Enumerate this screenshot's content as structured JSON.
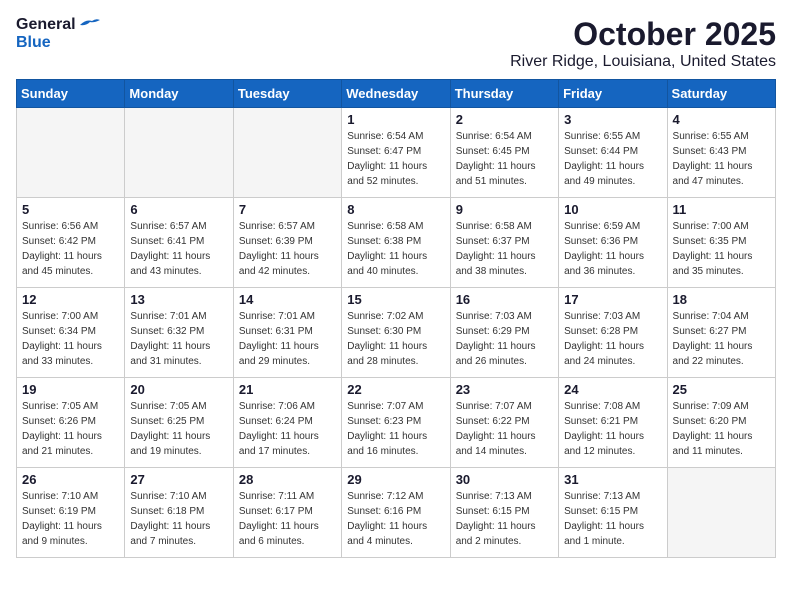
{
  "header": {
    "logo_general": "General",
    "logo_blue": "Blue",
    "month": "October 2025",
    "location": "River Ridge, Louisiana, United States"
  },
  "weekdays": [
    "Sunday",
    "Monday",
    "Tuesday",
    "Wednesday",
    "Thursday",
    "Friday",
    "Saturday"
  ],
  "weeks": [
    [
      {
        "day": "",
        "detail": ""
      },
      {
        "day": "",
        "detail": ""
      },
      {
        "day": "",
        "detail": ""
      },
      {
        "day": "1",
        "detail": "Sunrise: 6:54 AM\nSunset: 6:47 PM\nDaylight: 11 hours\nand 52 minutes."
      },
      {
        "day": "2",
        "detail": "Sunrise: 6:54 AM\nSunset: 6:45 PM\nDaylight: 11 hours\nand 51 minutes."
      },
      {
        "day": "3",
        "detail": "Sunrise: 6:55 AM\nSunset: 6:44 PM\nDaylight: 11 hours\nand 49 minutes."
      },
      {
        "day": "4",
        "detail": "Sunrise: 6:55 AM\nSunset: 6:43 PM\nDaylight: 11 hours\nand 47 minutes."
      }
    ],
    [
      {
        "day": "5",
        "detail": "Sunrise: 6:56 AM\nSunset: 6:42 PM\nDaylight: 11 hours\nand 45 minutes."
      },
      {
        "day": "6",
        "detail": "Sunrise: 6:57 AM\nSunset: 6:41 PM\nDaylight: 11 hours\nand 43 minutes."
      },
      {
        "day": "7",
        "detail": "Sunrise: 6:57 AM\nSunset: 6:39 PM\nDaylight: 11 hours\nand 42 minutes."
      },
      {
        "day": "8",
        "detail": "Sunrise: 6:58 AM\nSunset: 6:38 PM\nDaylight: 11 hours\nand 40 minutes."
      },
      {
        "day": "9",
        "detail": "Sunrise: 6:58 AM\nSunset: 6:37 PM\nDaylight: 11 hours\nand 38 minutes."
      },
      {
        "day": "10",
        "detail": "Sunrise: 6:59 AM\nSunset: 6:36 PM\nDaylight: 11 hours\nand 36 minutes."
      },
      {
        "day": "11",
        "detail": "Sunrise: 7:00 AM\nSunset: 6:35 PM\nDaylight: 11 hours\nand 35 minutes."
      }
    ],
    [
      {
        "day": "12",
        "detail": "Sunrise: 7:00 AM\nSunset: 6:34 PM\nDaylight: 11 hours\nand 33 minutes."
      },
      {
        "day": "13",
        "detail": "Sunrise: 7:01 AM\nSunset: 6:32 PM\nDaylight: 11 hours\nand 31 minutes."
      },
      {
        "day": "14",
        "detail": "Sunrise: 7:01 AM\nSunset: 6:31 PM\nDaylight: 11 hours\nand 29 minutes."
      },
      {
        "day": "15",
        "detail": "Sunrise: 7:02 AM\nSunset: 6:30 PM\nDaylight: 11 hours\nand 28 minutes."
      },
      {
        "day": "16",
        "detail": "Sunrise: 7:03 AM\nSunset: 6:29 PM\nDaylight: 11 hours\nand 26 minutes."
      },
      {
        "day": "17",
        "detail": "Sunrise: 7:03 AM\nSunset: 6:28 PM\nDaylight: 11 hours\nand 24 minutes."
      },
      {
        "day": "18",
        "detail": "Sunrise: 7:04 AM\nSunset: 6:27 PM\nDaylight: 11 hours\nand 22 minutes."
      }
    ],
    [
      {
        "day": "19",
        "detail": "Sunrise: 7:05 AM\nSunset: 6:26 PM\nDaylight: 11 hours\nand 21 minutes."
      },
      {
        "day": "20",
        "detail": "Sunrise: 7:05 AM\nSunset: 6:25 PM\nDaylight: 11 hours\nand 19 minutes."
      },
      {
        "day": "21",
        "detail": "Sunrise: 7:06 AM\nSunset: 6:24 PM\nDaylight: 11 hours\nand 17 minutes."
      },
      {
        "day": "22",
        "detail": "Sunrise: 7:07 AM\nSunset: 6:23 PM\nDaylight: 11 hours\nand 16 minutes."
      },
      {
        "day": "23",
        "detail": "Sunrise: 7:07 AM\nSunset: 6:22 PM\nDaylight: 11 hours\nand 14 minutes."
      },
      {
        "day": "24",
        "detail": "Sunrise: 7:08 AM\nSunset: 6:21 PM\nDaylight: 11 hours\nand 12 minutes."
      },
      {
        "day": "25",
        "detail": "Sunrise: 7:09 AM\nSunset: 6:20 PM\nDaylight: 11 hours\nand 11 minutes."
      }
    ],
    [
      {
        "day": "26",
        "detail": "Sunrise: 7:10 AM\nSunset: 6:19 PM\nDaylight: 11 hours\nand 9 minutes."
      },
      {
        "day": "27",
        "detail": "Sunrise: 7:10 AM\nSunset: 6:18 PM\nDaylight: 11 hours\nand 7 minutes."
      },
      {
        "day": "28",
        "detail": "Sunrise: 7:11 AM\nSunset: 6:17 PM\nDaylight: 11 hours\nand 6 minutes."
      },
      {
        "day": "29",
        "detail": "Sunrise: 7:12 AM\nSunset: 6:16 PM\nDaylight: 11 hours\nand 4 minutes."
      },
      {
        "day": "30",
        "detail": "Sunrise: 7:13 AM\nSunset: 6:15 PM\nDaylight: 11 hours\nand 2 minutes."
      },
      {
        "day": "31",
        "detail": "Sunrise: 7:13 AM\nSunset: 6:15 PM\nDaylight: 11 hours\nand 1 minute."
      },
      {
        "day": "",
        "detail": ""
      }
    ]
  ]
}
